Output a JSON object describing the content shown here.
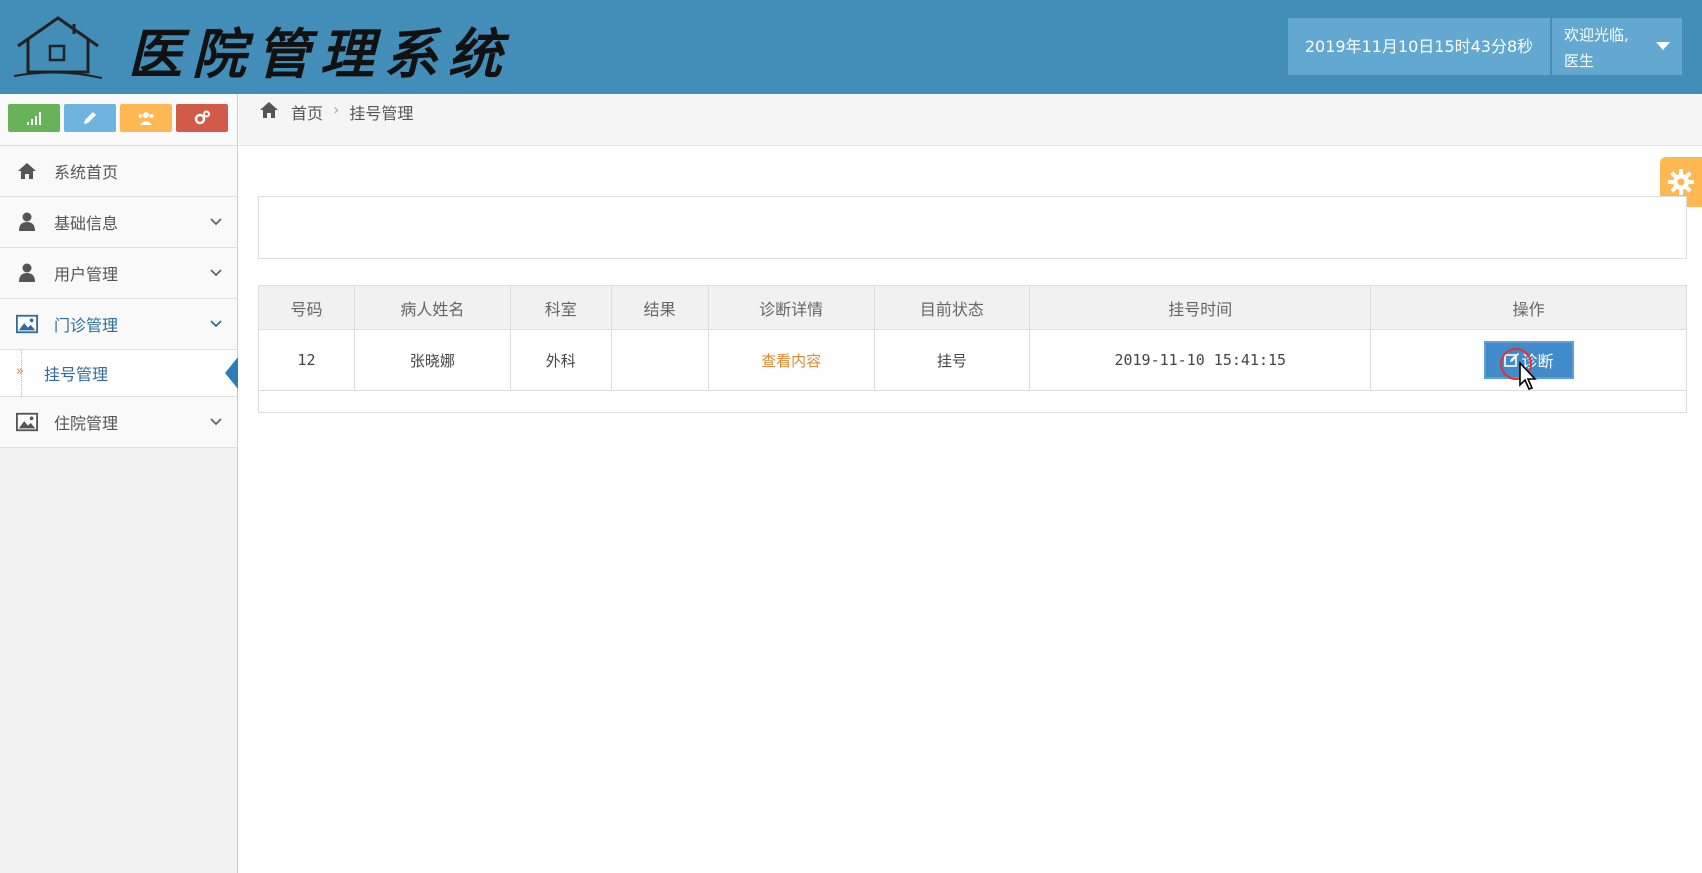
{
  "header": {
    "title": "医院管理系统",
    "datetime": "2019年11月10日15时43分8秒",
    "welcome": "欢迎光临,",
    "username": "医生"
  },
  "shortcuts": [
    {
      "name": "stats",
      "color": "#68b35a"
    },
    {
      "name": "edit",
      "color": "#6fb3e0"
    },
    {
      "name": "users",
      "color": "#ffb752"
    },
    {
      "name": "settings",
      "color": "#d15b47"
    }
  ],
  "sidebar": {
    "items": [
      {
        "label": "系统首页",
        "icon": "home-icon"
      },
      {
        "label": "基础信息",
        "icon": "user-icon"
      },
      {
        "label": "用户管理",
        "icon": "user-icon"
      },
      {
        "label": "门诊管理",
        "icon": "picture-icon"
      },
      {
        "label": "挂号管理",
        "icon": "double-angle-right-icon"
      },
      {
        "label": "住院管理",
        "icon": "picture-icon"
      }
    ]
  },
  "breadcrumb": {
    "home": "首页",
    "current": "挂号管理"
  },
  "table": {
    "headers": [
      "号码",
      "病人姓名",
      "科室",
      "结果",
      "诊断详情",
      "目前状态",
      "挂号时间",
      "操作"
    ],
    "rows": [
      {
        "number": "12",
        "patient": "张晓娜",
        "department": "外科",
        "result": "",
        "detail_link": "查看内容",
        "status": "挂号",
        "time": "2019-11-10 15:41:15",
        "action": "诊断"
      }
    ]
  }
}
